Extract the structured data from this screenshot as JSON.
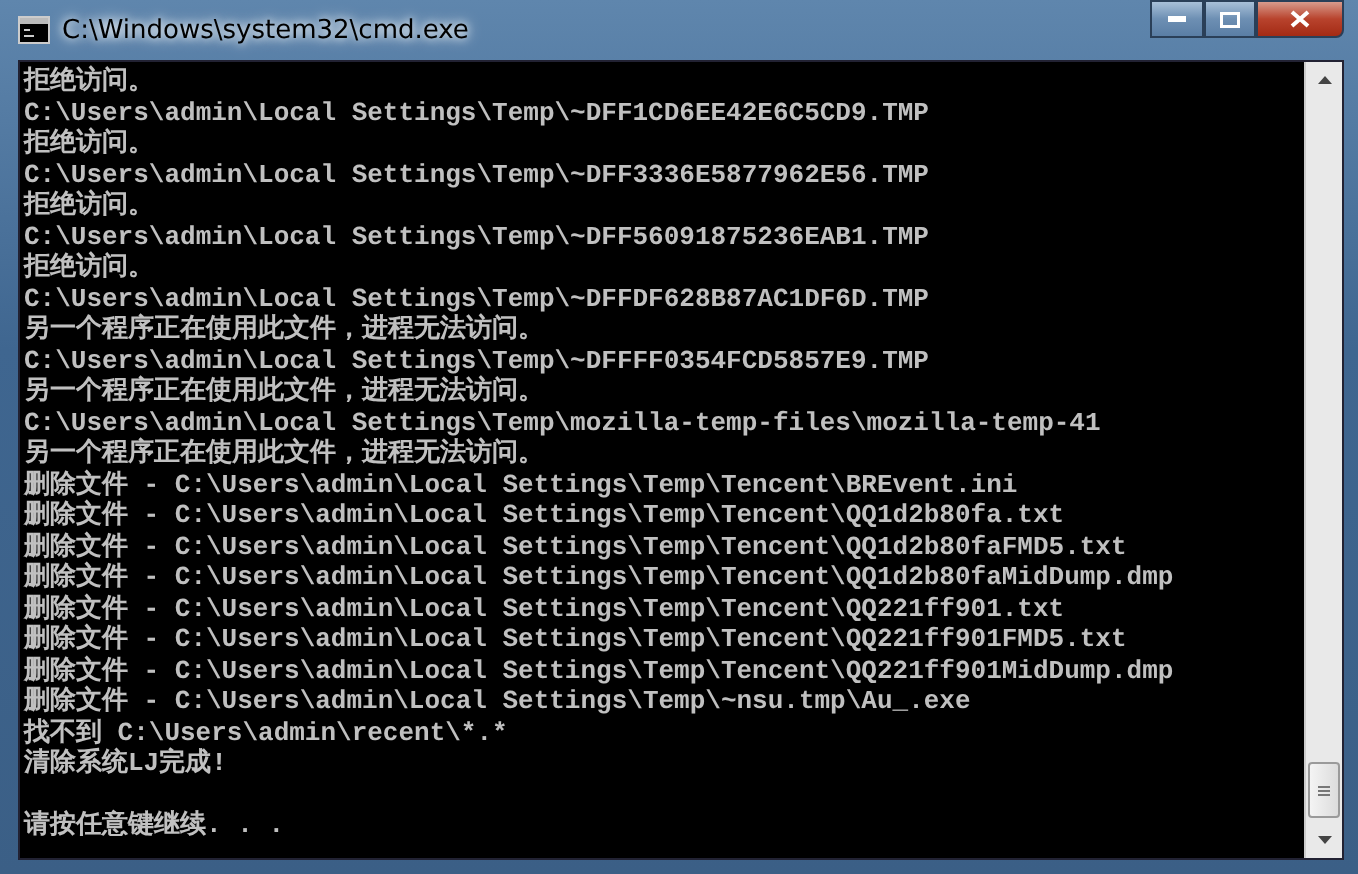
{
  "window": {
    "title": "C:\\Windows\\system32\\cmd.exe"
  },
  "console": {
    "lines": [
      "拒绝访问。",
      "C:\\Users\\admin\\Local Settings\\Temp\\~DFF1CD6EE42E6C5CD9.TMP",
      "拒绝访问。",
      "C:\\Users\\admin\\Local Settings\\Temp\\~DFF3336E5877962E56.TMP",
      "拒绝访问。",
      "C:\\Users\\admin\\Local Settings\\Temp\\~DFF56091875236EAB1.TMP",
      "拒绝访问。",
      "C:\\Users\\admin\\Local Settings\\Temp\\~DFFDF628B87AC1DF6D.TMP",
      "另一个程序正在使用此文件，进程无法访问。",
      "C:\\Users\\admin\\Local Settings\\Temp\\~DFFFF0354FCD5857E9.TMP",
      "另一个程序正在使用此文件，进程无法访问。",
      "C:\\Users\\admin\\Local Settings\\Temp\\mozilla-temp-files\\mozilla-temp-41",
      "另一个程序正在使用此文件，进程无法访问。",
      "删除文件 - C:\\Users\\admin\\Local Settings\\Temp\\Tencent\\BREvent.ini",
      "删除文件 - C:\\Users\\admin\\Local Settings\\Temp\\Tencent\\QQ1d2b80fa.txt",
      "删除文件 - C:\\Users\\admin\\Local Settings\\Temp\\Tencent\\QQ1d2b80faFMD5.txt",
      "删除文件 - C:\\Users\\admin\\Local Settings\\Temp\\Tencent\\QQ1d2b80faMidDump.dmp",
      "删除文件 - C:\\Users\\admin\\Local Settings\\Temp\\Tencent\\QQ221ff901.txt",
      "删除文件 - C:\\Users\\admin\\Local Settings\\Temp\\Tencent\\QQ221ff901FMD5.txt",
      "删除文件 - C:\\Users\\admin\\Local Settings\\Temp\\Tencent\\QQ221ff901MidDump.dmp",
      "删除文件 - C:\\Users\\admin\\Local Settings\\Temp\\~nsu.tmp\\Au_.exe",
      "找不到 C:\\Users\\admin\\recent\\*.*",
      "清除系统LJ完成!",
      {
        "kind": "blank"
      },
      "请按任意键继续. . ."
    ]
  }
}
